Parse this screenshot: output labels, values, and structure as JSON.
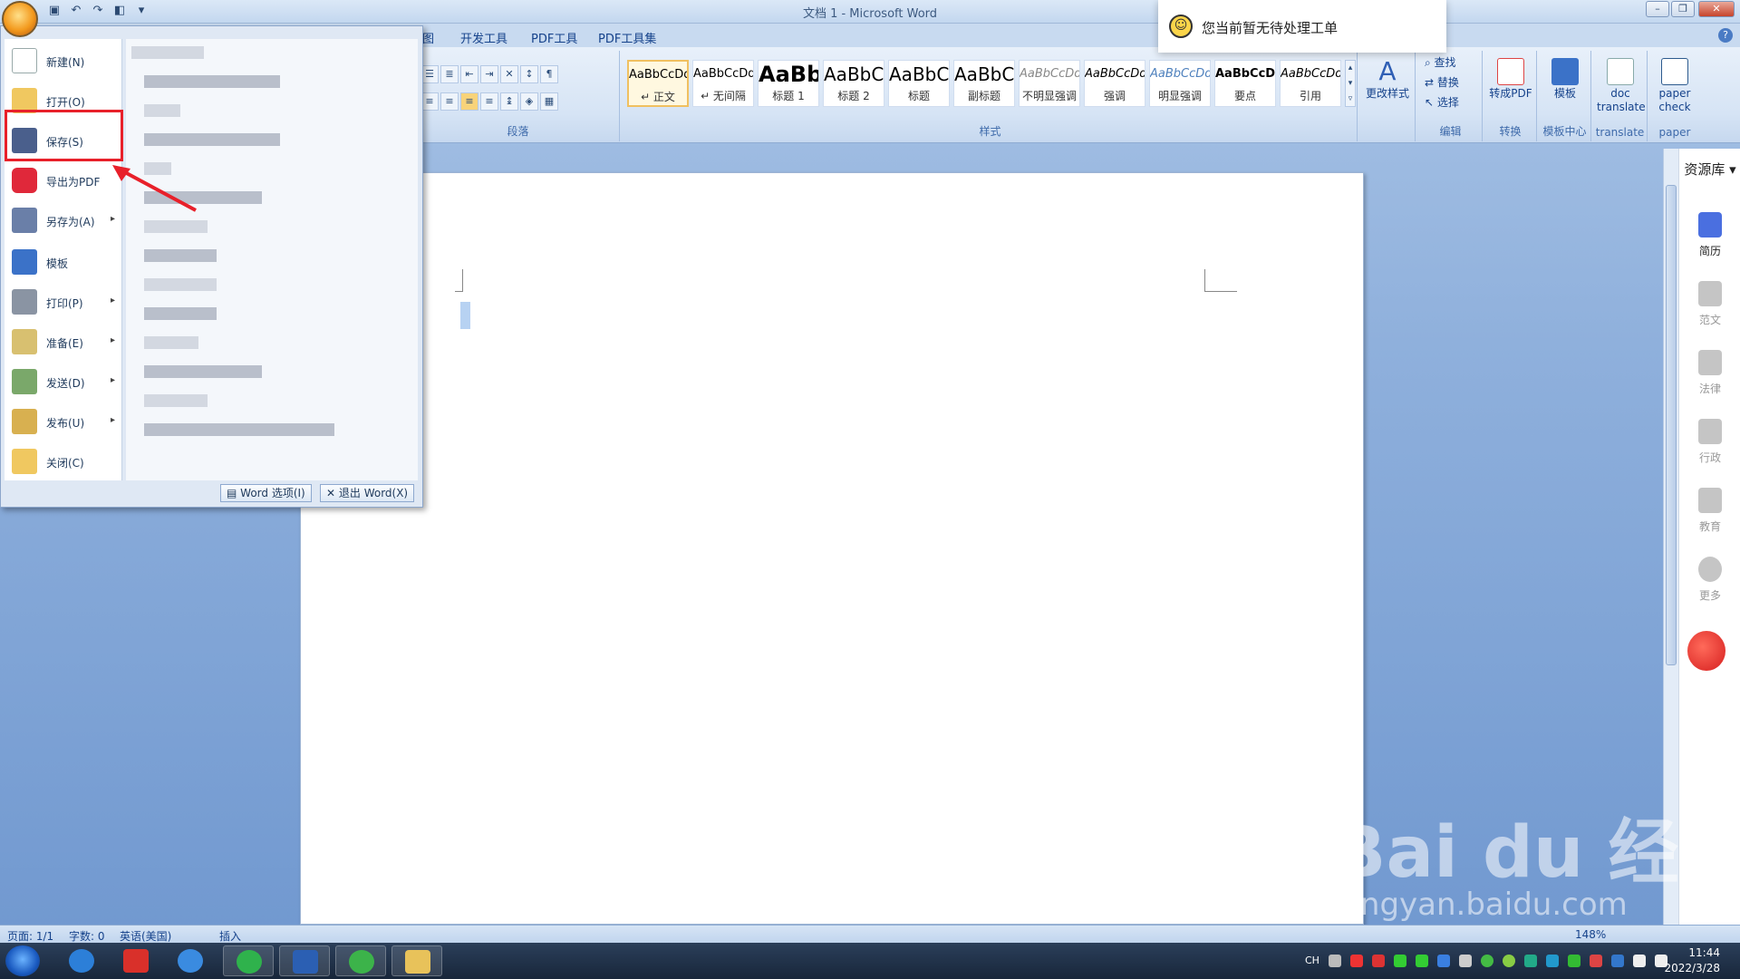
{
  "window": {
    "title": "文档 1 - Microsoft Word"
  },
  "tabs": [
    "图",
    "开发工具",
    "PDF工具",
    "PDF工具集"
  ],
  "ribbon": {
    "groups": {
      "paragraph": "段落",
      "styles": "样式",
      "edit": "编辑",
      "convert": "转换",
      "template_center": "模板中心",
      "translate": "translate",
      "paper": "paper"
    },
    "styles": [
      {
        "preview": "AaBbCcDd",
        "name": "↵ 正文"
      },
      {
        "preview": "AaBbCcDd",
        "name": "↵ 无间隔"
      },
      {
        "preview": "AaBb",
        "name": "标题 1"
      },
      {
        "preview": "AaBbC",
        "name": "标题 2"
      },
      {
        "preview": "AaBbC",
        "name": "标题"
      },
      {
        "preview": "AaBbC",
        "name": "副标题"
      },
      {
        "preview": "AaBbCcDd",
        "name": "不明显强调"
      },
      {
        "preview": "AaBbCcDd",
        "name": "强调"
      },
      {
        "preview": "AaBbCcDd",
        "name": "明显强调"
      },
      {
        "preview": "AaBbCcDd",
        "name": "要点"
      },
      {
        "preview": "AaBbCcDd",
        "name": "引用"
      }
    ],
    "change_styles": "更改样式",
    "find": "查找",
    "replace": "替换",
    "select": "选择",
    "to_pdf": "转成PDF",
    "template": "模板",
    "doc_translate": "doc translate",
    "paper_check": "paper check"
  },
  "office_menu": {
    "items": [
      {
        "label": "新建(N)",
        "arrow": ""
      },
      {
        "label": "打开(O)",
        "arrow": ""
      },
      {
        "label": "保存(S)",
        "arrow": ""
      },
      {
        "label": "导出为PDF",
        "arrow": ""
      },
      {
        "label": "另存为(A)",
        "arrow": "▸"
      },
      {
        "label": "模板",
        "arrow": ""
      },
      {
        "label": "打印(P)",
        "arrow": "▸"
      },
      {
        "label": "准备(E)",
        "arrow": "▸"
      },
      {
        "label": "发送(D)",
        "arrow": "▸"
      },
      {
        "label": "发布(U)",
        "arrow": "▸"
      },
      {
        "label": "关闭(C)",
        "arrow": ""
      }
    ],
    "word_options": "Word 选项(I)",
    "exit_word": "退出 Word(X)"
  },
  "notification": {
    "text": "您当前暂无待处理工单"
  },
  "resource_pane": {
    "title": "资源库",
    "items": [
      {
        "label": "简历",
        "active": true
      },
      {
        "label": "范文",
        "active": false
      },
      {
        "label": "法律",
        "active": false
      },
      {
        "label": "行政",
        "active": false
      },
      {
        "label": "教育",
        "active": false
      },
      {
        "label": "更多",
        "active": false
      }
    ]
  },
  "statusbar": {
    "page": "页面: 1/1",
    "words": "字数: 0",
    "language": "英语(美国)",
    "mode": "插入",
    "zoom": "148%"
  },
  "taskbar": {
    "lang": "CH",
    "time": "11:44",
    "date": "2022/3/28"
  },
  "watermark": {
    "brand": "Bai du 经验",
    "url": "jingyan.baidu.com"
  },
  "colors": {
    "accent": "#15428b",
    "highlight": "#e8202a",
    "ribbon_bg": "#d6e4f5"
  }
}
